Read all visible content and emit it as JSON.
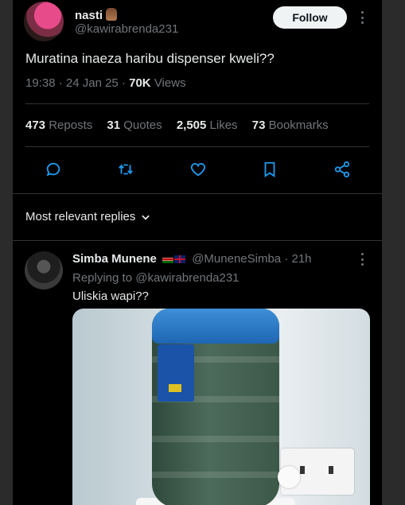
{
  "tweet": {
    "author_name": "nasti",
    "author_handle": "@kawirabrenda231",
    "follow_label": "Follow",
    "text": "Muratina inaeza haribu dispenser kweli??",
    "time": "19:38",
    "date": "24 Jan 25",
    "views": "70K",
    "views_label": "Views",
    "stats": {
      "reposts": "473",
      "reposts_label": "Reposts",
      "quotes": "31",
      "quotes_label": "Quotes",
      "likes": "2,505",
      "likes_label": "Likes",
      "bookmarks": "73",
      "bookmarks_label": "Bookmarks"
    },
    "actions": [
      "reply-icon",
      "repost-icon",
      "like-icon",
      "bookmark-icon",
      "share-icon"
    ]
  },
  "replies_sort": {
    "label": "Most relevant replies"
  },
  "reply": {
    "author_name": "Simba Munene",
    "author_handle": "@MuneneSimba",
    "time": "21h",
    "replying_prefix": "Replying to",
    "replying_to": "@kawirabrenda231",
    "text": "Uliskia wapi??"
  },
  "colors": {
    "background": "#000000",
    "text": "#e7e9ea",
    "muted": "#71767b",
    "divider": "#2f3336",
    "follow_bg": "#eff3f4"
  }
}
